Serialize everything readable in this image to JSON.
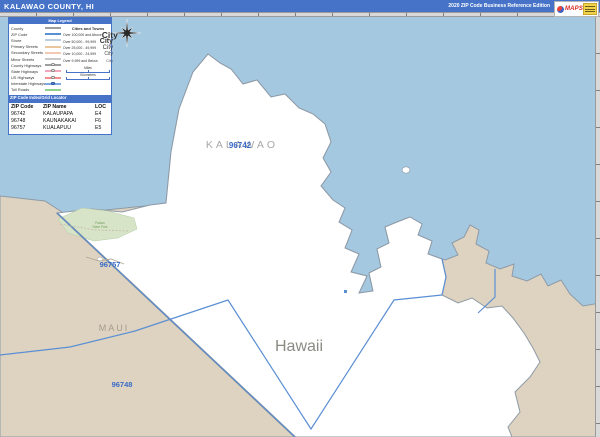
{
  "title_bar": {
    "title": "KALAWAO COUNTY, HI",
    "edition": "2020 ZIP Code Business Reference Edition"
  },
  "logo": {
    "brand": "MAPS"
  },
  "legend": {
    "header": "Map Legend",
    "line_items": [
      {
        "label": "County",
        "color": "#9e9e9e"
      },
      {
        "label": "ZIP Code",
        "color": "#5b8fd4"
      },
      {
        "label": "Shore",
        "color": "#b9cfdf"
      },
      {
        "label": "Primary Streets",
        "color": "#e9c79c"
      },
      {
        "label": "Secondary Streets",
        "color": "#f3c9b4"
      },
      {
        "label": "Minor Streets",
        "color": "#c9c9c9"
      },
      {
        "label": "County Highways",
        "color": "#9e9e9e"
      },
      {
        "label": "State Highways",
        "color": "#f2a7bb"
      },
      {
        "label": "US Highways",
        "color": "#ef8f8f"
      },
      {
        "label": "Interstate Highways",
        "color": "#7fa7e3"
      },
      {
        "label": "Toll Roads",
        "color": "#8fd08f"
      }
    ],
    "cities_header": "Cities and Towns",
    "city_classes": [
      {
        "range": "Over 100,000 and Above",
        "sample": "City"
      },
      {
        "range": "Over 50,000 - 99,999",
        "sample": "City"
      },
      {
        "range": "Over 25,000 - 49,999",
        "sample": "City"
      },
      {
        "range": "Over 10,000 - 24,999",
        "sample": "City"
      },
      {
        "range": "Over 9,999 and Below",
        "sample": "City"
      }
    ],
    "scales": [
      {
        "label": "Miles"
      },
      {
        "label": "Kilometers"
      }
    ]
  },
  "zip_index": {
    "header": "ZIP Code Index/Grid Locator",
    "columns": [
      "ZIP Code",
      "ZIP Name",
      "LOC"
    ],
    "rows": [
      [
        "96742",
        "KALAUPAPA",
        "E4"
      ],
      [
        "96748",
        "KAUNAKAKAI",
        "F6"
      ],
      [
        "96757",
        "KUALAPUU",
        "E5"
      ]
    ]
  },
  "map": {
    "labels": {
      "county_name": "KALAWAO",
      "county_zip": "96742",
      "zip_96757": "96757",
      "zip_96748": "96748",
      "neighbor_county": "MAUI",
      "state_label": "Hawaii",
      "park_line1": "Palaau",
      "park_line2": "State Park"
    },
    "colors": {
      "water": "#a5c8e1",
      "land": "#ddd3c0",
      "county_fill": "#ffffff",
      "zip_line": "#5b8fd4",
      "park": "#d7e4c8",
      "zip_label": "#3a6bc8"
    }
  }
}
